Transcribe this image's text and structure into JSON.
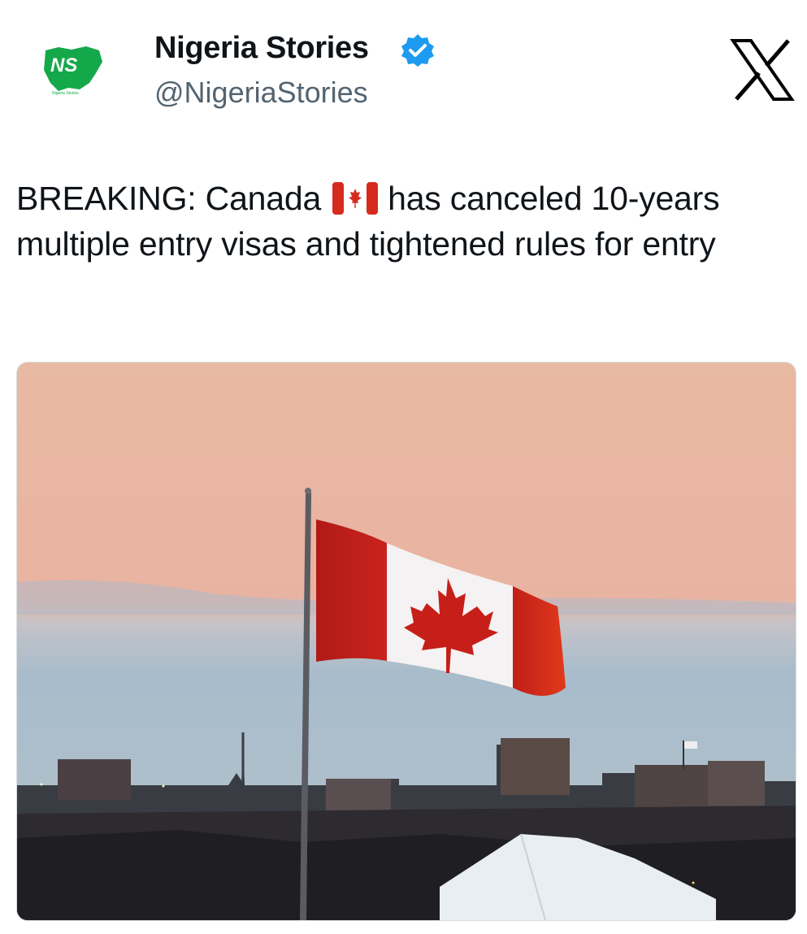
{
  "author": {
    "display_name": "Nigeria Stories",
    "handle": "@NigeriaStories",
    "avatar_text": "NS",
    "avatar_caption": "Nigeria Stories",
    "verified": true
  },
  "tweet": {
    "text_part1": "BREAKING: Canada",
    "flag_emoji": "canada-flag",
    "text_part2": "has canceled 10-years multiple entry visas and tightened rules for entry"
  },
  "colors": {
    "verified_blue": "#1d9bf0",
    "nigeria_green": "#15a84a",
    "canada_red": "#d52b1e"
  },
  "icons": [
    "verified-badge-icon",
    "x-logo-icon",
    "canada-flag-emoji"
  ]
}
